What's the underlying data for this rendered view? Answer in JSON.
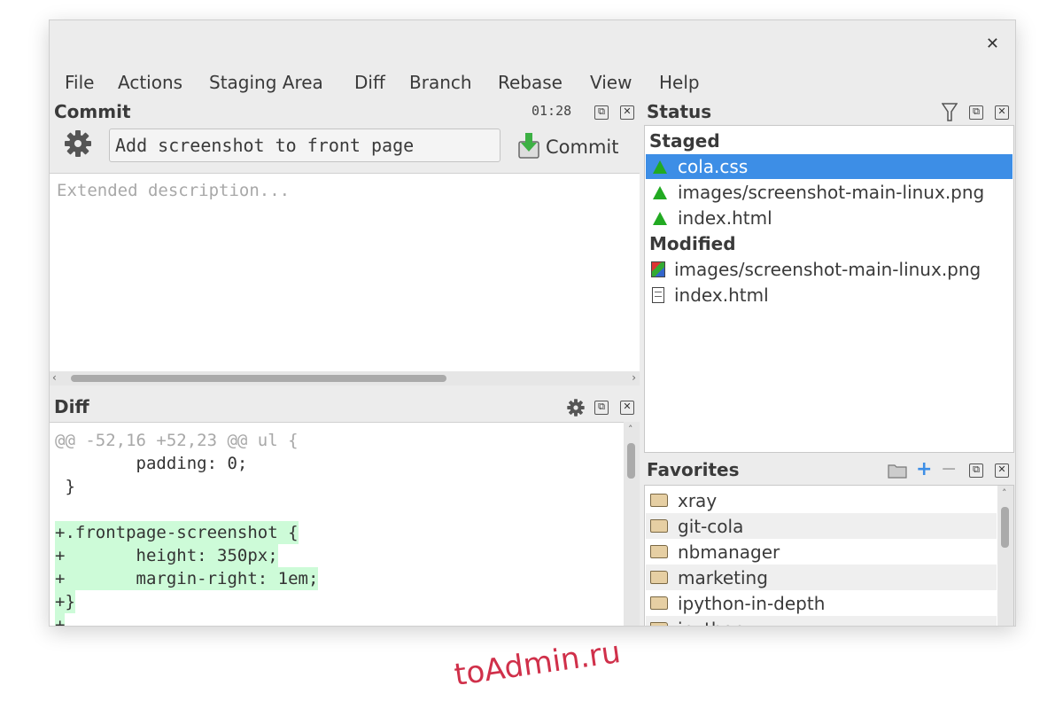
{
  "menu": [
    "File",
    "Actions",
    "Staging Area",
    "Diff",
    "Branch",
    "Rebase",
    "View",
    "Help"
  ],
  "commit": {
    "title": "Commit",
    "timer": "01:28",
    "summary_value": "Add screenshot to front page",
    "commit_label": "Commit",
    "description_placeholder": "Extended description..."
  },
  "diff": {
    "title": "Diff",
    "lines": [
      {
        "text": "@@ -52,16 +52,23 @@ ul {",
        "kind": "hunk"
      },
      {
        "text": "        padding: 0;",
        "kind": "context"
      },
      {
        "text": " }",
        "kind": "context"
      },
      {
        "text": "",
        "kind": "context"
      },
      {
        "text": "+.frontpage-screenshot {",
        "kind": "add"
      },
      {
        "text": "+       height: 350px;",
        "kind": "add"
      },
      {
        "text": "+       margin-right: 1em;",
        "kind": "add"
      },
      {
        "text": "+}",
        "kind": "add"
      },
      {
        "text": "+",
        "kind": "add"
      }
    ]
  },
  "status": {
    "title": "Status",
    "staged_header": "Staged",
    "staged": [
      "cola.css",
      "images/screenshot-main-linux.png",
      "index.html"
    ],
    "modified_header": "Modified",
    "modified": [
      "images/screenshot-main-linux.png",
      "index.html"
    ]
  },
  "favorites": {
    "title": "Favorites",
    "items": [
      "xray",
      "git-cola",
      "nbmanager",
      "marketing",
      "ipython-in-depth",
      "ipython"
    ]
  },
  "watermark": "toAdmin.ru",
  "colors": {
    "selection": "#3d8ee6",
    "added_line": "#cdfbd8",
    "staged_icon": "#22aa22",
    "watermark": "#d0304a"
  }
}
